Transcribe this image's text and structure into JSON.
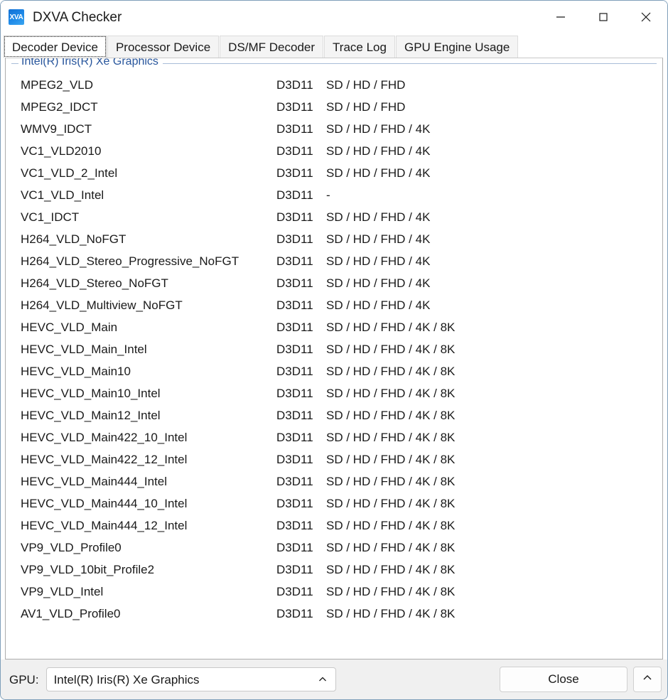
{
  "window": {
    "title": "DXVA Checker",
    "icon_label": "XVA",
    "icon_name": "dxva-checker-app-icon",
    "controls": [
      {
        "name": "minimize-button",
        "glyph": "minimize-icon",
        "label": "Minimize"
      },
      {
        "name": "maximize-button",
        "glyph": "maximize-icon",
        "label": "Maximize"
      },
      {
        "name": "close-window-button",
        "glyph": "close-icon",
        "label": "Close"
      }
    ],
    "border_color": "#7f9fba"
  },
  "tabs": [
    {
      "label": "Decoder Device",
      "active": true
    },
    {
      "label": "Processor Device",
      "active": false
    },
    {
      "label": "DS/MF Decoder",
      "active": false
    },
    {
      "label": "Trace Log",
      "active": false
    },
    {
      "label": "GPU Engine Usage",
      "active": false
    }
  ],
  "decoder_panel": {
    "group_label": "Intel(R) Iris(R) Xe Graphics",
    "group_label_color": "#27559c",
    "rows": [
      {
        "name": "MPEG2_VLD",
        "api": "D3D11",
        "resolutions": "SD / HD / FHD"
      },
      {
        "name": "MPEG2_IDCT",
        "api": "D3D11",
        "resolutions": "SD / HD / FHD"
      },
      {
        "name": "WMV9_IDCT",
        "api": "D3D11",
        "resolutions": "SD / HD / FHD / 4K"
      },
      {
        "name": "VC1_VLD2010",
        "api": "D3D11",
        "resolutions": "SD / HD / FHD / 4K"
      },
      {
        "name": "VC1_VLD_2_Intel",
        "api": "D3D11",
        "resolutions": "SD / HD / FHD / 4K"
      },
      {
        "name": "VC1_VLD_Intel",
        "api": "D3D11",
        "resolutions": "-"
      },
      {
        "name": "VC1_IDCT",
        "api": "D3D11",
        "resolutions": "SD / HD / FHD / 4K"
      },
      {
        "name": "H264_VLD_NoFGT",
        "api": "D3D11",
        "resolutions": "SD / HD / FHD / 4K"
      },
      {
        "name": "H264_VLD_Stereo_Progressive_NoFGT",
        "api": "D3D11",
        "resolutions": "SD / HD / FHD / 4K"
      },
      {
        "name": "H264_VLD_Stereo_NoFGT",
        "api": "D3D11",
        "resolutions": "SD / HD / FHD / 4K"
      },
      {
        "name": "H264_VLD_Multiview_NoFGT",
        "api": "D3D11",
        "resolutions": "SD / HD / FHD / 4K"
      },
      {
        "name": "HEVC_VLD_Main",
        "api": "D3D11",
        "resolutions": "SD / HD / FHD / 4K / 8K"
      },
      {
        "name": "HEVC_VLD_Main_Intel",
        "api": "D3D11",
        "resolutions": "SD / HD / FHD / 4K / 8K"
      },
      {
        "name": "HEVC_VLD_Main10",
        "api": "D3D11",
        "resolutions": "SD / HD / FHD / 4K / 8K"
      },
      {
        "name": "HEVC_VLD_Main10_Intel",
        "api": "D3D11",
        "resolutions": "SD / HD / FHD / 4K / 8K"
      },
      {
        "name": "HEVC_VLD_Main12_Intel",
        "api": "D3D11",
        "resolutions": "SD / HD / FHD / 4K / 8K"
      },
      {
        "name": "HEVC_VLD_Main422_10_Intel",
        "api": "D3D11",
        "resolutions": "SD / HD / FHD / 4K / 8K"
      },
      {
        "name": "HEVC_VLD_Main422_12_Intel",
        "api": "D3D11",
        "resolutions": "SD / HD / FHD / 4K / 8K"
      },
      {
        "name": "HEVC_VLD_Main444_Intel",
        "api": "D3D11",
        "resolutions": "SD / HD / FHD / 4K / 8K"
      },
      {
        "name": "HEVC_VLD_Main444_10_Intel",
        "api": "D3D11",
        "resolutions": "SD / HD / FHD / 4K / 8K"
      },
      {
        "name": "HEVC_VLD_Main444_12_Intel",
        "api": "D3D11",
        "resolutions": "SD / HD / FHD / 4K / 8K"
      },
      {
        "name": "VP9_VLD_Profile0",
        "api": "D3D11",
        "resolutions": "SD / HD / FHD / 4K / 8K"
      },
      {
        "name": "VP9_VLD_10bit_Profile2",
        "api": "D3D11",
        "resolutions": "SD / HD / FHD / 4K / 8K"
      },
      {
        "name": "VP9_VLD_Intel",
        "api": "D3D11",
        "resolutions": "SD / HD / FHD / 4K / 8K"
      },
      {
        "name": "AV1_VLD_Profile0",
        "api": "D3D11",
        "resolutions": "SD / HD / FHD / 4K / 8K"
      }
    ]
  },
  "bottom": {
    "gpu_label": "GPU:",
    "gpu_selected": "Intel(R) Iris(R) Xe Graphics",
    "gpu_chevron": "chevron-up-icon",
    "close_label": "Close",
    "expand_chevron": "chevron-up-icon"
  }
}
